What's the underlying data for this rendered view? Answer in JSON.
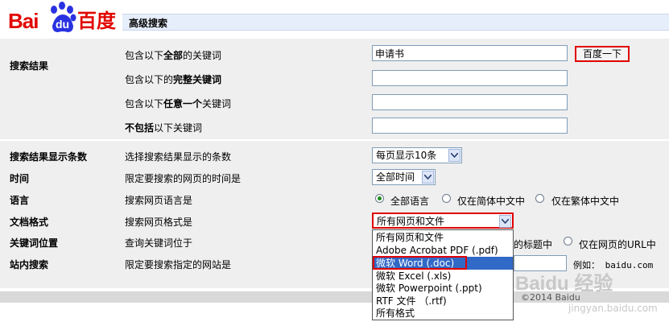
{
  "logo": {
    "text_left": "Bai",
    "paw_text": "du",
    "text_cn": "百度"
  },
  "header": {
    "title": "高级搜索"
  },
  "sections": {
    "results": "搜索结果",
    "count": "搜索结果显示条数",
    "time": "时间",
    "lang": "语言",
    "format": "文档格式",
    "position": "关键词位置",
    "site": "站内搜索"
  },
  "rows": {
    "all_pre": "包含以下",
    "all_bold": "全部",
    "all_post": "的关键词",
    "exact_pre": "包含以下的",
    "exact_bold": "完整关键词",
    "any_pre": "包含以下",
    "any_bold": "任意一个",
    "any_post": "关键词",
    "none_bold": "不包括",
    "none_post": "以下关键词",
    "count_desc": "选择搜索结果显示的条数",
    "time_desc": "限定要搜索的网页的时间是",
    "lang_desc": "搜索网页语言是",
    "format_desc": "搜索网页格式是",
    "position_desc": "查询关键词位于",
    "site_desc": "限定要搜索指定的网站是"
  },
  "inputs": {
    "all_value": "申请书",
    "exact_value": "",
    "any_value": "",
    "none_value": ""
  },
  "buttons": {
    "search": "百度一下"
  },
  "selects": {
    "count": "每页显示10条",
    "time": "全部时间",
    "format": "所有网页和文件"
  },
  "lang_options": [
    "全部语言",
    "仅在简体中文中",
    "仅在繁体中文中"
  ],
  "position_options": {
    "title": "的标题中",
    "url": "仅在网页的URL中"
  },
  "site_example": "例如： baidu.com",
  "dropdown_options": [
    "所有网页和文件",
    "Adobe Acrobat PDF (.pdf)",
    "微软 Word (.doc)",
    "微软 Excel (.xls)",
    "微软 Powerpoint (.ppt)",
    "RTF 文件 （.rtf)",
    "所有格式"
  ],
  "watermark": {
    "text": "Baidu 经验",
    "url": "jingyan.baidu.com"
  },
  "copyright": "©2014 Baidu"
}
